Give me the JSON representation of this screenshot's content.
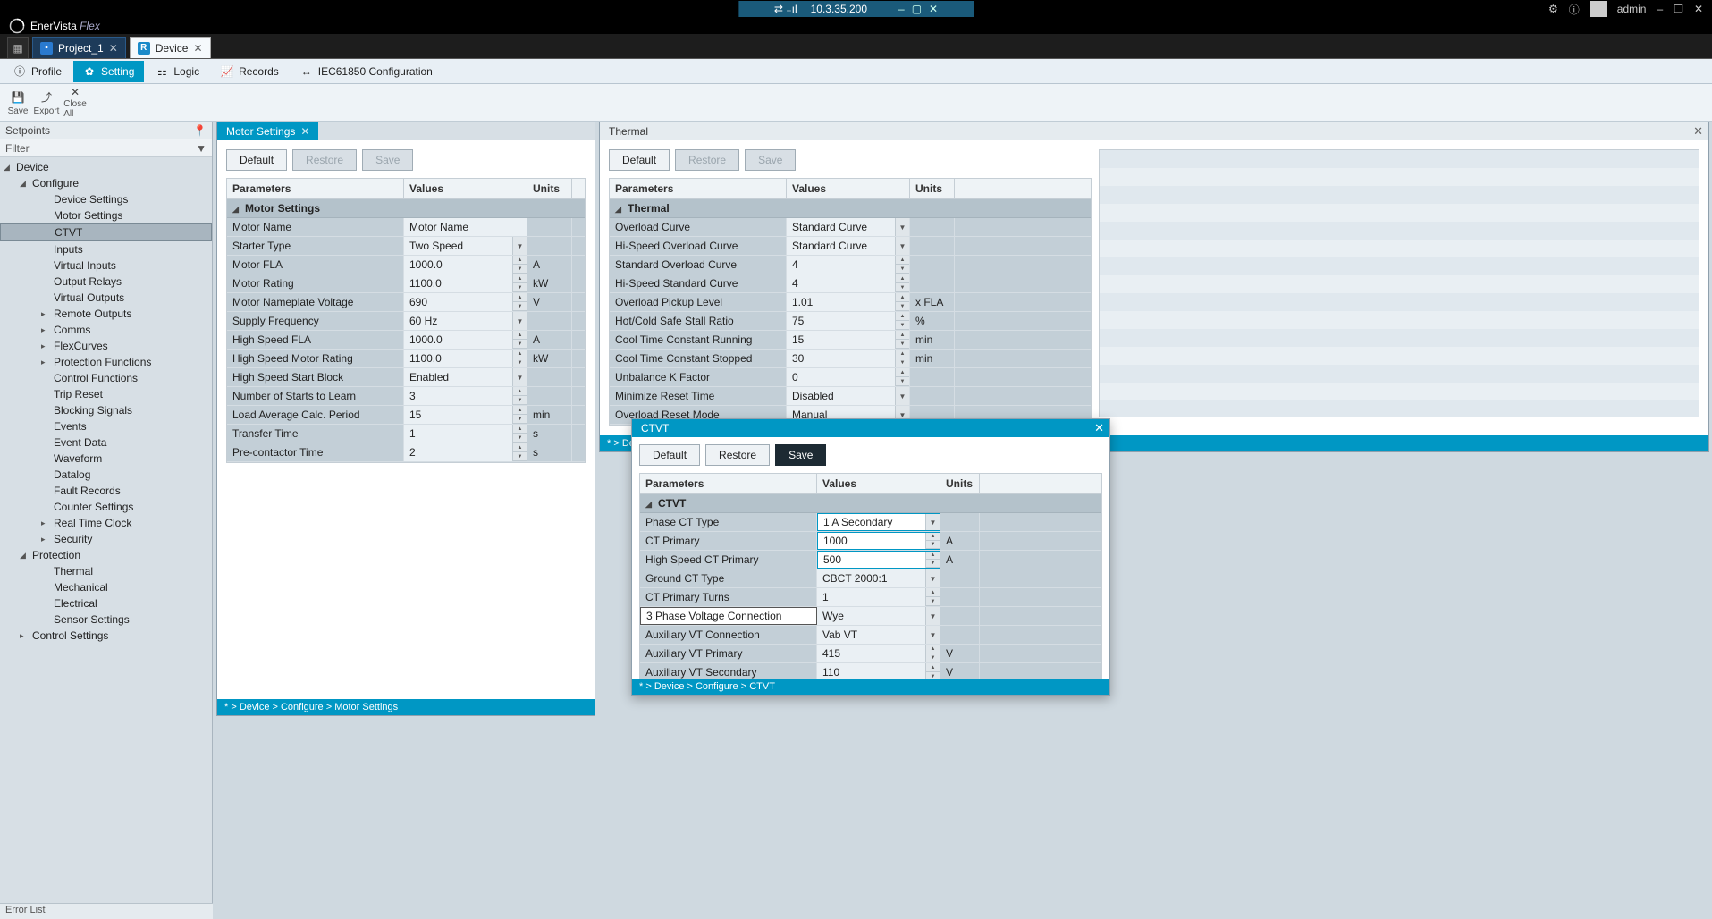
{
  "brand": {
    "name": "EnerVista",
    "suffix": " Flex"
  },
  "titlebar": {
    "ip": "10.3.35.200",
    "user": "admin"
  },
  "tabs": {
    "project": "Project_1",
    "device": "Device"
  },
  "ribbon": {
    "profile": "Profile",
    "setting": "Setting",
    "logic": "Logic",
    "records": "Records",
    "iec": "IEC61850 Configuration"
  },
  "actions": {
    "save": "Save",
    "export": "Export",
    "closeall": "Close All"
  },
  "leftpanel": {
    "title": "Setpoints",
    "filter": "Filter"
  },
  "tree": {
    "device": "Device",
    "configure": "Configure",
    "items_cfg": [
      "Device Settings",
      "Motor Settings",
      "CTVT",
      "Inputs",
      "Virtual Inputs",
      "Output Relays",
      "Virtual Outputs",
      "Remote Outputs",
      "Comms",
      "FlexCurves",
      "Protection Functions",
      "Control Functions",
      "Trip Reset",
      "Blocking Signals",
      "Events",
      "Event Data",
      "Waveform",
      "Datalog",
      "Fault Records",
      "Counter Settings",
      "Real Time Clock",
      "Security"
    ],
    "protection": "Protection",
    "items_prot": [
      "Thermal",
      "Mechanical",
      "Electrical",
      "Sensor Settings"
    ],
    "ctrl": "Control Settings"
  },
  "panels": {
    "motor": {
      "tab": "Motor Settings",
      "btns": {
        "default": "Default",
        "restore": "Restore",
        "save": "Save"
      },
      "cols": {
        "params": "Parameters",
        "values": "Values",
        "units": "Units"
      },
      "section": "Motor Settings",
      "rows": [
        {
          "p": "Motor Name",
          "v": "Motor Name",
          "u": "",
          "t": "text"
        },
        {
          "p": "Starter Type",
          "v": "Two Speed",
          "u": "",
          "t": "drop"
        },
        {
          "p": "Motor FLA",
          "v": "1000.0",
          "u": "A",
          "t": "spin"
        },
        {
          "p": "Motor Rating",
          "v": "1100.0",
          "u": "kW",
          "t": "spin"
        },
        {
          "p": "Motor Nameplate Voltage",
          "v": "690",
          "u": "V",
          "t": "spin"
        },
        {
          "p": "Supply Frequency",
          "v": "60 Hz",
          "u": "",
          "t": "drop"
        },
        {
          "p": "High Speed FLA",
          "v": "1000.0",
          "u": "A",
          "t": "spin"
        },
        {
          "p": "High Speed Motor Rating",
          "v": "1100.0",
          "u": "kW",
          "t": "spin"
        },
        {
          "p": "High Speed Start Block",
          "v": "Enabled",
          "u": "",
          "t": "drop"
        },
        {
          "p": "Number of Starts to Learn",
          "v": "3",
          "u": "",
          "t": "spin"
        },
        {
          "p": "Load Average Calc. Period",
          "v": "15",
          "u": "min",
          "t": "spin"
        },
        {
          "p": "Transfer Time",
          "v": "1",
          "u": "s",
          "t": "spin"
        },
        {
          "p": "Pre-contactor Time",
          "v": "2",
          "u": "s",
          "t": "spin"
        }
      ],
      "bc": "* > Device > Configure > Motor Settings"
    },
    "thermal": {
      "tab": "Thermal",
      "cols": {
        "params": "Parameters",
        "values": "Values",
        "units": "Units"
      },
      "section": "Thermal",
      "btns": {
        "default": "Default",
        "restore": "Restore",
        "save": "Save"
      },
      "rows": [
        {
          "p": "Overload Curve",
          "v": "Standard Curve",
          "u": "",
          "t": "drop"
        },
        {
          "p": "Hi-Speed Overload Curve",
          "v": "Standard Curve",
          "u": "",
          "t": "drop"
        },
        {
          "p": "Standard Overload Curve",
          "v": "4",
          "u": "",
          "t": "spin"
        },
        {
          "p": "Hi-Speed Standard Curve",
          "v": "4",
          "u": "",
          "t": "spin"
        },
        {
          "p": "Overload Pickup Level",
          "v": "1.01",
          "u": "x FLA",
          "t": "spin"
        },
        {
          "p": "Hot/Cold Safe Stall Ratio",
          "v": "75",
          "u": "%",
          "t": "spin"
        },
        {
          "p": "Cool Time Constant Running",
          "v": "15",
          "u": "min",
          "t": "spin"
        },
        {
          "p": "Cool Time Constant Stopped",
          "v": "30",
          "u": "min",
          "t": "spin"
        },
        {
          "p": "Unbalance K Factor",
          "v": "0",
          "u": "",
          "t": "spin"
        },
        {
          "p": "Minimize Reset Time",
          "v": "Disabled",
          "u": "",
          "t": "drop"
        },
        {
          "p": "Overload Reset Mode",
          "v": "Manual",
          "u": "",
          "t": "drop"
        }
      ],
      "bc": "* > Devi"
    },
    "ctvt": {
      "tab": "CTVT",
      "btns": {
        "default": "Default",
        "restore": "Restore",
        "save": "Save"
      },
      "cols": {
        "params": "Parameters",
        "values": "Values",
        "units": "Units"
      },
      "section": "CTVT",
      "rows": [
        {
          "p": "Phase CT Type",
          "v": "1 A Secondary",
          "u": "",
          "t": "drop",
          "hl": true
        },
        {
          "p": "CT Primary",
          "v": "1000",
          "u": "A",
          "t": "spin",
          "hl": true
        },
        {
          "p": "High Speed CT Primary",
          "v": "500",
          "u": "A",
          "t": "spin",
          "hl": true
        },
        {
          "p": "Ground CT Type",
          "v": "CBCT 2000:1",
          "u": "",
          "t": "drop"
        },
        {
          "p": "CT Primary Turns",
          "v": "1",
          "u": "",
          "t": "spin"
        },
        {
          "p": "3 Phase Voltage Connection",
          "v": "Wye",
          "u": "",
          "t": "drop",
          "psel": true
        },
        {
          "p": "Auxiliary VT Connection",
          "v": "Vab VT",
          "u": "",
          "t": "drop"
        },
        {
          "p": "Auxiliary VT Primary",
          "v": "415",
          "u": "V",
          "t": "spin"
        },
        {
          "p": "Auxiliary VT Secondary",
          "v": "110",
          "u": "V",
          "t": "spin"
        }
      ],
      "bc": "* > Device > Configure > CTVT"
    }
  },
  "errorlist": "Error List"
}
